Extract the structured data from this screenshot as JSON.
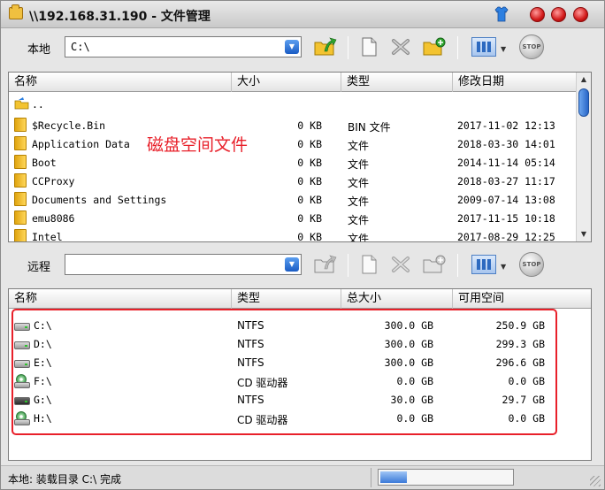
{
  "window": {
    "title": "\\\\192.168.31.190 - 文件管理",
    "colors": {
      "close": "#d21a1a",
      "accent": "#2866c7",
      "annotation": "#e8202a"
    }
  },
  "local_toolbar": {
    "label": "本地",
    "path": "C:\\"
  },
  "remote_toolbar": {
    "label": "远程",
    "path": ""
  },
  "toolbar_buttons": {
    "up_dir": "folder-up-icon",
    "new_file": "new-file-icon",
    "delete": "delete-icon",
    "new_folder": "new-folder-icon",
    "view": "view-mode-icon",
    "stop": "STOP"
  },
  "local_list": {
    "columns": [
      "名称",
      "大小",
      "类型",
      "修改日期"
    ],
    "parent_label": "..",
    "rows": [
      {
        "name": "$Recycle.Bin",
        "size": "0 KB",
        "type": "BIN 文件",
        "date": "2017-11-02 12:13"
      },
      {
        "name": "Application Data",
        "size": "0 KB",
        "type": "文件",
        "date": "2018-03-30 14:01"
      },
      {
        "name": "Boot",
        "size": "0 KB",
        "type": "文件",
        "date": "2014-11-14 05:14"
      },
      {
        "name": "CCProxy",
        "size": "0 KB",
        "type": "文件",
        "date": "2018-03-27 11:17"
      },
      {
        "name": "Documents and Settings",
        "size": "0 KB",
        "type": "文件",
        "date": "2009-07-14 13:08"
      },
      {
        "name": "emu8086",
        "size": "0 KB",
        "type": "文件",
        "date": "2017-11-15 10:18"
      },
      {
        "name": "Intel",
        "size": "0 KB",
        "type": "文件",
        "date": "2017-08-29 12:25"
      }
    ]
  },
  "annotation": {
    "label": "磁盘空间文件"
  },
  "remote_list": {
    "columns": [
      "名称",
      "类型",
      "总大小",
      "可用空间"
    ],
    "rows": [
      {
        "name": "C:\\",
        "type": "NTFS",
        "total": "300.0 GB",
        "free": "250.9 GB",
        "icon": "hard-drive-icon"
      },
      {
        "name": "D:\\",
        "type": "NTFS",
        "total": "300.0 GB",
        "free": "299.3 GB",
        "icon": "hard-drive-icon"
      },
      {
        "name": "E:\\",
        "type": "NTFS",
        "total": "300.0 GB",
        "free": "296.6 GB",
        "icon": "hard-drive-icon"
      },
      {
        "name": "F:\\",
        "type": "CD 驱动器",
        "total": "0.0 GB",
        "free": "0.0 GB",
        "icon": "cd-drive-icon"
      },
      {
        "name": "G:\\",
        "type": "NTFS",
        "total": "30.0 GB",
        "free": "29.7 GB",
        "icon": "hard-drive-icon"
      },
      {
        "name": "H:\\",
        "type": "CD 驱动器",
        "total": "0.0 GB",
        "free": "0.0 GB",
        "icon": "cd-drive-icon"
      }
    ]
  },
  "status": {
    "text": "本地: 装载目录 C:\\ 完成",
    "progress": 0.2
  }
}
